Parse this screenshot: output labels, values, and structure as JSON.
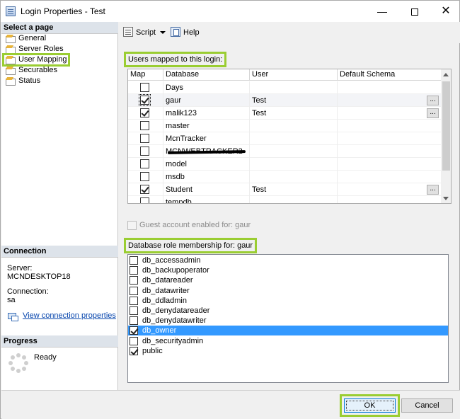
{
  "window": {
    "title": "Login Properties - Test",
    "min_glyph": "—",
    "close_glyph": "✕"
  },
  "left": {
    "select_page_header": "Select a page",
    "pages": [
      {
        "label": "General"
      },
      {
        "label": "Server Roles"
      },
      {
        "label": "User Mapping",
        "selected": true
      },
      {
        "label": "Securables"
      },
      {
        "label": "Status"
      }
    ],
    "connection_header": "Connection",
    "server_label": "Server:",
    "server_value": "MCNDESKTOP18",
    "connection_label": "Connection:",
    "connection_value": "sa",
    "view_props_link": "View connection properties",
    "progress_header": "Progress",
    "progress_status": "Ready"
  },
  "toolbar": {
    "script_label": "Script",
    "help_label": "Help"
  },
  "mapping": {
    "group_label": "Users mapped to this login:",
    "columns": [
      "Map",
      "Database",
      "User",
      "Default Schema"
    ],
    "rows": [
      {
        "db": "Days",
        "user": "",
        "checked": false
      },
      {
        "db": "gaur",
        "user": "Test",
        "checked": true,
        "focus": true,
        "ellipsis": true
      },
      {
        "db": "malik123",
        "user": "Test",
        "checked": true,
        "ellipsis": true
      },
      {
        "db": "master",
        "user": "",
        "checked": false
      },
      {
        "db": "McnTracker",
        "user": "",
        "checked": false
      },
      {
        "db": "MCNWEBTRACKER2",
        "user": "",
        "checked": false,
        "redacted": true
      },
      {
        "db": "model",
        "user": "",
        "checked": false
      },
      {
        "db": "msdb",
        "user": "",
        "checked": false
      },
      {
        "db": "Student",
        "user": "Test",
        "checked": true,
        "ellipsis": true
      },
      {
        "db": "tempdb",
        "user": "",
        "checked": false
      }
    ],
    "ellipsis_glyph": "..."
  },
  "guest": {
    "label": "Guest account enabled for: gaur"
  },
  "roles": {
    "group_label": "Database role membership for: gaur",
    "items": [
      {
        "label": "db_accessadmin",
        "checked": false
      },
      {
        "label": "db_backupoperator",
        "checked": false
      },
      {
        "label": "db_datareader",
        "checked": false
      },
      {
        "label": "db_datawriter",
        "checked": false
      },
      {
        "label": "db_ddladmin",
        "checked": false
      },
      {
        "label": "db_denydatareader",
        "checked": false
      },
      {
        "label": "db_denydatawriter",
        "checked": false
      },
      {
        "label": "db_owner",
        "checked": true,
        "selected": true
      },
      {
        "label": "db_securityadmin",
        "checked": false
      },
      {
        "label": "public",
        "checked": true
      }
    ]
  },
  "footer": {
    "ok_label": "OK",
    "cancel_label": "Cancel"
  }
}
